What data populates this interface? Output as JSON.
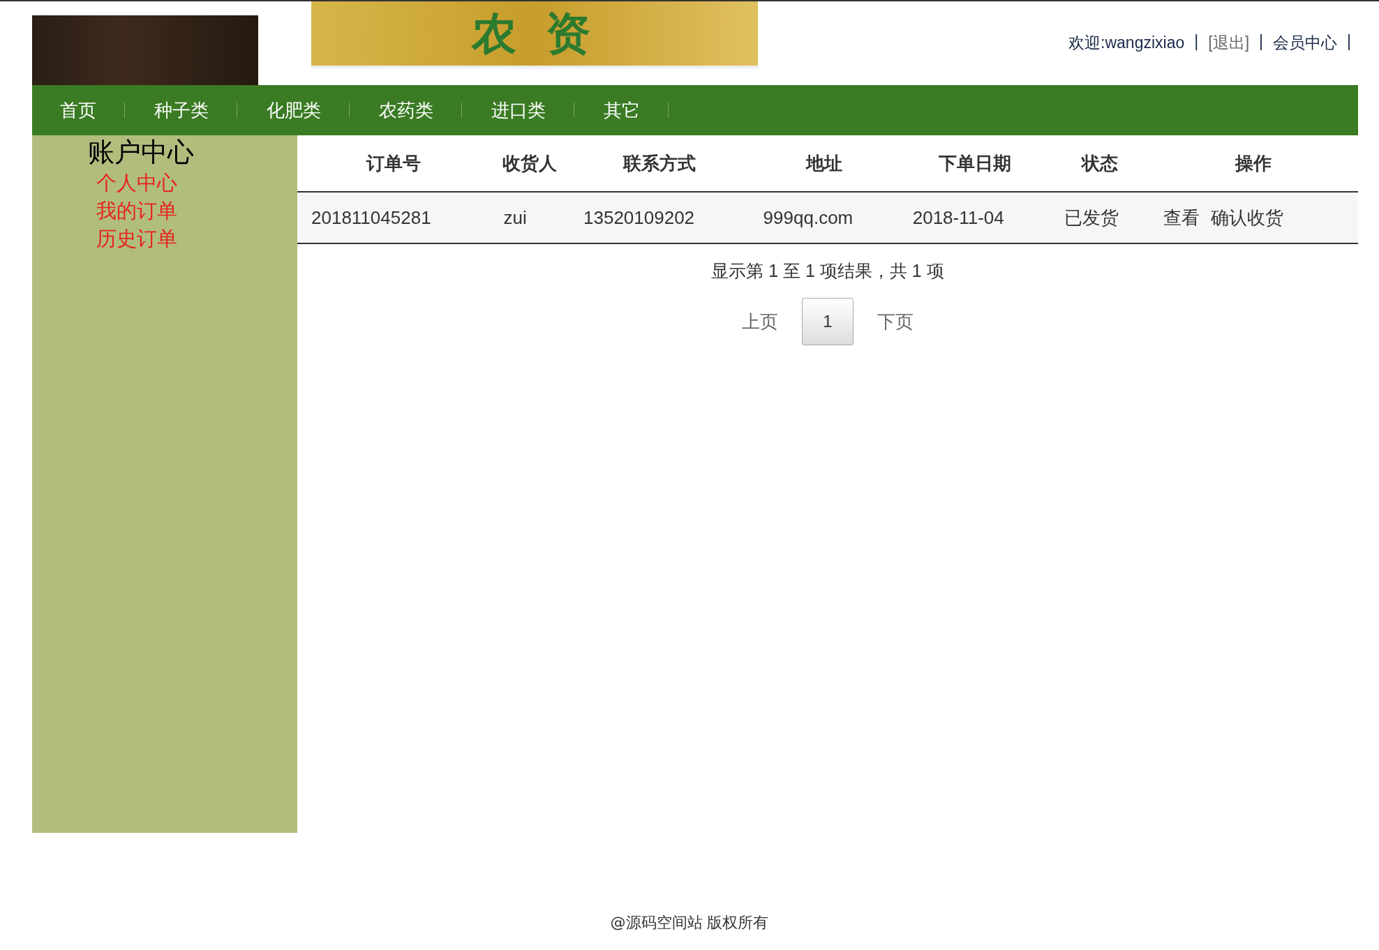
{
  "header": {
    "logo_text": "农 资",
    "user_links": [
      {
        "kind": "text",
        "label": "欢迎:wangzixiao"
      },
      {
        "kind": "sep",
        "label": "|"
      },
      {
        "kind": "link",
        "label": "[退出]"
      },
      {
        "kind": "sep",
        "label": "|"
      },
      {
        "kind": "text",
        "label": "会员中心"
      },
      {
        "kind": "sep",
        "label": "|"
      }
    ]
  },
  "nav": {
    "items": [
      {
        "label": "首页"
      },
      {
        "label": "种子类"
      },
      {
        "label": "化肥类"
      },
      {
        "label": "农药类"
      },
      {
        "label": "进口类"
      },
      {
        "label": "其它"
      }
    ]
  },
  "sidebar": {
    "title": "账户中心",
    "items": [
      {
        "label": "个人中心"
      },
      {
        "label": "我的订单"
      },
      {
        "label": "历史订单"
      }
    ]
  },
  "table": {
    "columns": [
      "订单号",
      "收货人",
      "联系方式",
      "地址",
      "下单日期",
      "状态",
      "操作"
    ],
    "rows": [
      {
        "cells": [
          "201811045281",
          "zui",
          "13520109202",
          "999qq.com",
          "2018-11-04",
          "已发货"
        ],
        "actions": [
          "查看",
          "确认收货"
        ]
      }
    ]
  },
  "pagination": {
    "summary": "显示第 1 至 1 项结果，共 1 项",
    "prev": "上页",
    "pages": [
      {
        "label": "1",
        "selected": true
      }
    ],
    "next": "下页"
  },
  "footer": {
    "text": "@源码空间站 版权所有"
  }
}
